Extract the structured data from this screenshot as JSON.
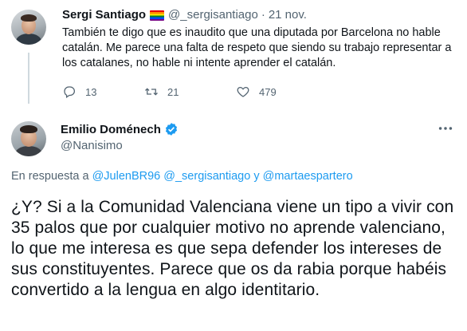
{
  "tweet1": {
    "author_name": "Sergi Santiago",
    "author_handle": "@_sergisantiago",
    "separator": "·",
    "date": "21 nov.",
    "text": "También te digo que es inaudito que una diputada por Barcelona no hable catalán. Me parece una falta de respeto que siendo su trabajo representar a los catalanes, no hable ni intente aprender el catalán.",
    "replies": "13",
    "retweets": "21",
    "likes": "479"
  },
  "tweet2": {
    "author_name": "Emilio Doménech",
    "author_handle": "@Nanisimo",
    "verified": true,
    "reply_prefix": "En respuesta a",
    "reply_users": [
      "@JulenBR96",
      "@_sergisantiago",
      "@martaespartero"
    ],
    "reply_joiner": "y",
    "text": "¿Y? Si a la Comunidad Valenciana viene un tipo a vivir con 35 palos que por cualquier motivo no aprende valenciano, lo que me interesa es que sepa defender los intereses de sus constituyentes. Parece que os da rabia porque habéis convertido a la lengua en algo identitario."
  },
  "icons": {
    "flag": "rainbow-flag-icon",
    "reply": "reply-icon",
    "retweet": "retweet-icon",
    "like": "heart-icon",
    "verified": "verified-badge-icon",
    "more": "more-icon"
  },
  "colors": {
    "link": "#1d9bf0",
    "muted": "#536471",
    "text": "#0f1419",
    "thread_line": "#cfd9de"
  }
}
